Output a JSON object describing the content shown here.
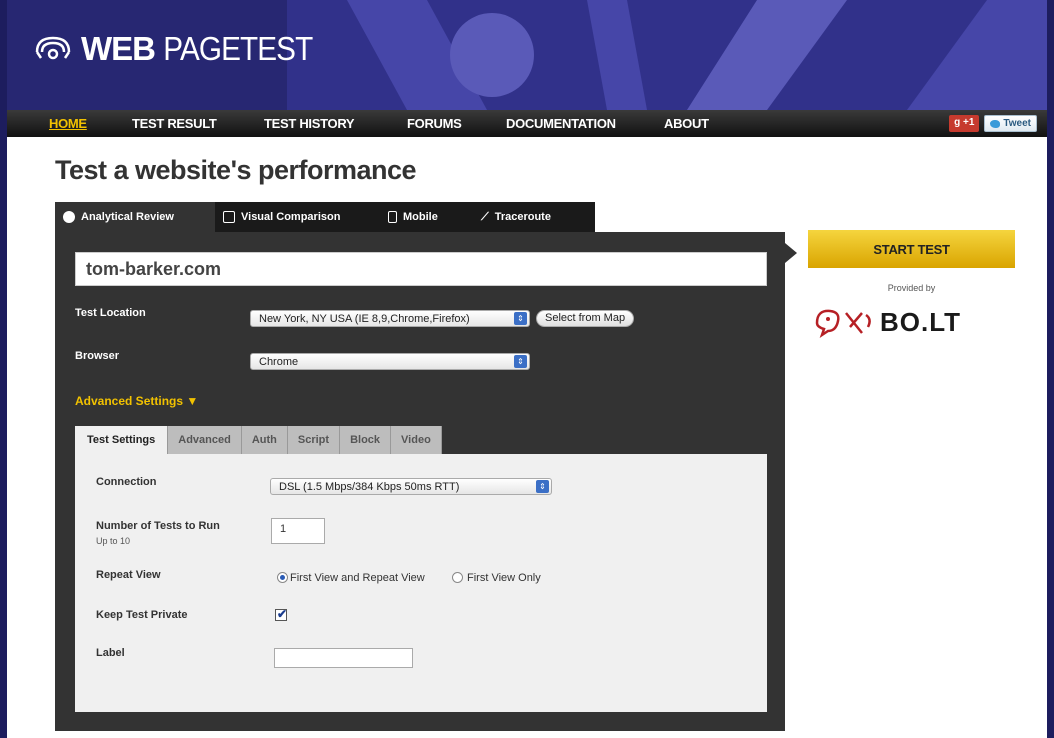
{
  "brand": {
    "logo_bold": "WEB",
    "logo_light": "PAGETEST"
  },
  "nav": {
    "items": [
      {
        "label": "HOME",
        "active": true
      },
      {
        "label": "TEST RESULT",
        "active": false
      },
      {
        "label": "TEST HISTORY",
        "active": false
      },
      {
        "label": "FORUMS",
        "active": false
      },
      {
        "label": "DOCUMENTATION",
        "active": false
      },
      {
        "label": "ABOUT",
        "active": false
      }
    ],
    "gplus_label": "+1",
    "tweet_label": "Tweet"
  },
  "page_title": "Test a website's performance",
  "main_tabs": [
    {
      "label": "Analytical Review",
      "icon": "analytics-icon",
      "active": true
    },
    {
      "label": "Visual Comparison",
      "icon": "document-icon",
      "active": false
    },
    {
      "label": "Mobile",
      "icon": "mobile-icon",
      "active": false
    },
    {
      "label": "Traceroute",
      "icon": "traceroute-icon",
      "active": false
    }
  ],
  "form": {
    "url_value": "tom-barker.com",
    "test_location_label": "Test Location",
    "test_location_value": "New York, NY USA (IE 8,9,Chrome,Firefox)",
    "select_from_map_label": "Select from Map",
    "browser_label": "Browser",
    "browser_value": "Chrome",
    "advanced_settings_label": "Advanced Settings ▼"
  },
  "inner_tabs": [
    {
      "label": "Test Settings",
      "active": true
    },
    {
      "label": "Advanced",
      "active": false
    },
    {
      "label": "Auth",
      "active": false
    },
    {
      "label": "Script",
      "active": false
    },
    {
      "label": "Block",
      "active": false
    },
    {
      "label": "Video",
      "active": false
    }
  ],
  "settings": {
    "connection_label": "Connection",
    "connection_value": "DSL (1.5 Mbps/384 Kbps 50ms RTT)",
    "num_tests_label": "Number of Tests to Run",
    "num_tests_sub": "Up to 10",
    "num_tests_value": "1",
    "repeat_view_label": "Repeat View",
    "repeat_option_1": "First View and Repeat View",
    "repeat_option_2": "First View Only",
    "repeat_selected": 1,
    "keep_private_label": "Keep Test Private",
    "keep_private_checked": true,
    "label_label": "Label",
    "label_value": ""
  },
  "sidebar": {
    "start_test_label": "START TEST",
    "provided_by": "Provided by",
    "sponsor_name": "BO.LT"
  },
  "colors": {
    "banner": "#272772",
    "accent_yellow": "#f2c200",
    "panel_dark": "#333333"
  }
}
